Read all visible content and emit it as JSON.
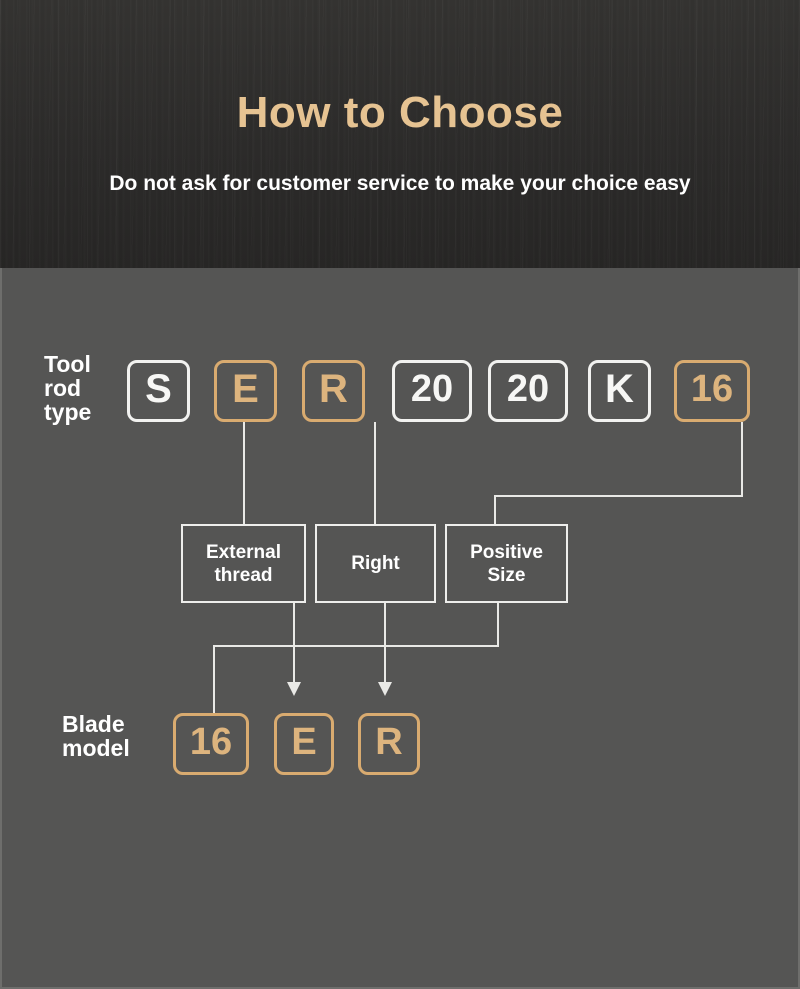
{
  "header": {
    "title": "How to Choose",
    "subtitle": "Do not ask for customer service to make your choice easy",
    "title_color": "#e6c392",
    "subtitle_color": "#ffffff",
    "background_color": "#2e2d2c"
  },
  "body": {
    "background_color": "#555554",
    "line_color": "#e9e9e6",
    "accent_color": "#ddb47e"
  },
  "tool_rod": {
    "label": "Tool\nrod\ntype",
    "codes": [
      {
        "text": "S",
        "style": "white"
      },
      {
        "text": "E",
        "style": "tan"
      },
      {
        "text": "R",
        "style": "tan"
      },
      {
        "text": "20",
        "style": "white"
      },
      {
        "text": "20",
        "style": "white"
      },
      {
        "text": "K",
        "style": "white"
      },
      {
        "text": "16",
        "style": "tan"
      }
    ]
  },
  "descriptions": [
    {
      "text": "External\nthread"
    },
    {
      "text": "Right"
    },
    {
      "text": "Positive\nSize"
    }
  ],
  "blade_model": {
    "label": "Blade\nmodel",
    "codes": [
      {
        "text": "16",
        "style": "tan"
      },
      {
        "text": "E",
        "style": "tan"
      },
      {
        "text": "R",
        "style": "tan"
      }
    ]
  }
}
